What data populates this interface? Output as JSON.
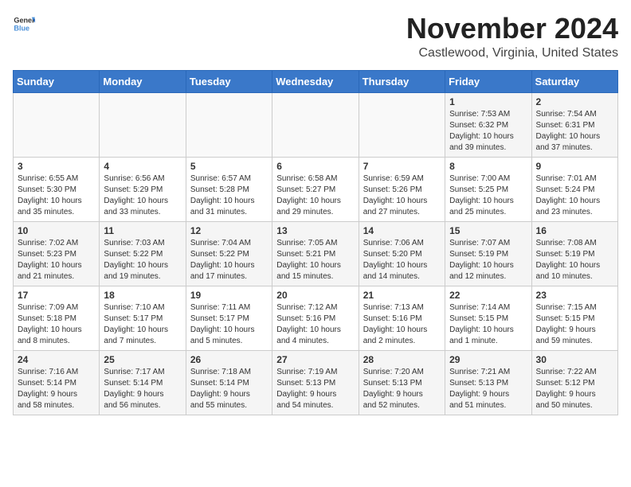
{
  "header": {
    "logo_general": "General",
    "logo_blue": "Blue",
    "month": "November 2024",
    "location": "Castlewood, Virginia, United States"
  },
  "weekdays": [
    "Sunday",
    "Monday",
    "Tuesday",
    "Wednesday",
    "Thursday",
    "Friday",
    "Saturday"
  ],
  "weeks": [
    [
      {
        "day": "",
        "info": ""
      },
      {
        "day": "",
        "info": ""
      },
      {
        "day": "",
        "info": ""
      },
      {
        "day": "",
        "info": ""
      },
      {
        "day": "",
        "info": ""
      },
      {
        "day": "1",
        "info": "Sunrise: 7:53 AM\nSunset: 6:32 PM\nDaylight: 10 hours\nand 39 minutes."
      },
      {
        "day": "2",
        "info": "Sunrise: 7:54 AM\nSunset: 6:31 PM\nDaylight: 10 hours\nand 37 minutes."
      }
    ],
    [
      {
        "day": "3",
        "info": "Sunrise: 6:55 AM\nSunset: 5:30 PM\nDaylight: 10 hours\nand 35 minutes."
      },
      {
        "day": "4",
        "info": "Sunrise: 6:56 AM\nSunset: 5:29 PM\nDaylight: 10 hours\nand 33 minutes."
      },
      {
        "day": "5",
        "info": "Sunrise: 6:57 AM\nSunset: 5:28 PM\nDaylight: 10 hours\nand 31 minutes."
      },
      {
        "day": "6",
        "info": "Sunrise: 6:58 AM\nSunset: 5:27 PM\nDaylight: 10 hours\nand 29 minutes."
      },
      {
        "day": "7",
        "info": "Sunrise: 6:59 AM\nSunset: 5:26 PM\nDaylight: 10 hours\nand 27 minutes."
      },
      {
        "day": "8",
        "info": "Sunrise: 7:00 AM\nSunset: 5:25 PM\nDaylight: 10 hours\nand 25 minutes."
      },
      {
        "day": "9",
        "info": "Sunrise: 7:01 AM\nSunset: 5:24 PM\nDaylight: 10 hours\nand 23 minutes."
      }
    ],
    [
      {
        "day": "10",
        "info": "Sunrise: 7:02 AM\nSunset: 5:23 PM\nDaylight: 10 hours\nand 21 minutes."
      },
      {
        "day": "11",
        "info": "Sunrise: 7:03 AM\nSunset: 5:22 PM\nDaylight: 10 hours\nand 19 minutes."
      },
      {
        "day": "12",
        "info": "Sunrise: 7:04 AM\nSunset: 5:22 PM\nDaylight: 10 hours\nand 17 minutes."
      },
      {
        "day": "13",
        "info": "Sunrise: 7:05 AM\nSunset: 5:21 PM\nDaylight: 10 hours\nand 15 minutes."
      },
      {
        "day": "14",
        "info": "Sunrise: 7:06 AM\nSunset: 5:20 PM\nDaylight: 10 hours\nand 14 minutes."
      },
      {
        "day": "15",
        "info": "Sunrise: 7:07 AM\nSunset: 5:19 PM\nDaylight: 10 hours\nand 12 minutes."
      },
      {
        "day": "16",
        "info": "Sunrise: 7:08 AM\nSunset: 5:19 PM\nDaylight: 10 hours\nand 10 minutes."
      }
    ],
    [
      {
        "day": "17",
        "info": "Sunrise: 7:09 AM\nSunset: 5:18 PM\nDaylight: 10 hours\nand 8 minutes."
      },
      {
        "day": "18",
        "info": "Sunrise: 7:10 AM\nSunset: 5:17 PM\nDaylight: 10 hours\nand 7 minutes."
      },
      {
        "day": "19",
        "info": "Sunrise: 7:11 AM\nSunset: 5:17 PM\nDaylight: 10 hours\nand 5 minutes."
      },
      {
        "day": "20",
        "info": "Sunrise: 7:12 AM\nSunset: 5:16 PM\nDaylight: 10 hours\nand 4 minutes."
      },
      {
        "day": "21",
        "info": "Sunrise: 7:13 AM\nSunset: 5:16 PM\nDaylight: 10 hours\nand 2 minutes."
      },
      {
        "day": "22",
        "info": "Sunrise: 7:14 AM\nSunset: 5:15 PM\nDaylight: 10 hours\nand 1 minute."
      },
      {
        "day": "23",
        "info": "Sunrise: 7:15 AM\nSunset: 5:15 PM\nDaylight: 9 hours\nand 59 minutes."
      }
    ],
    [
      {
        "day": "24",
        "info": "Sunrise: 7:16 AM\nSunset: 5:14 PM\nDaylight: 9 hours\nand 58 minutes."
      },
      {
        "day": "25",
        "info": "Sunrise: 7:17 AM\nSunset: 5:14 PM\nDaylight: 9 hours\nand 56 minutes."
      },
      {
        "day": "26",
        "info": "Sunrise: 7:18 AM\nSunset: 5:14 PM\nDaylight: 9 hours\nand 55 minutes."
      },
      {
        "day": "27",
        "info": "Sunrise: 7:19 AM\nSunset: 5:13 PM\nDaylight: 9 hours\nand 54 minutes."
      },
      {
        "day": "28",
        "info": "Sunrise: 7:20 AM\nSunset: 5:13 PM\nDaylight: 9 hours\nand 52 minutes."
      },
      {
        "day": "29",
        "info": "Sunrise: 7:21 AM\nSunset: 5:13 PM\nDaylight: 9 hours\nand 51 minutes."
      },
      {
        "day": "30",
        "info": "Sunrise: 7:22 AM\nSunset: 5:12 PM\nDaylight: 9 hours\nand 50 minutes."
      }
    ]
  ]
}
